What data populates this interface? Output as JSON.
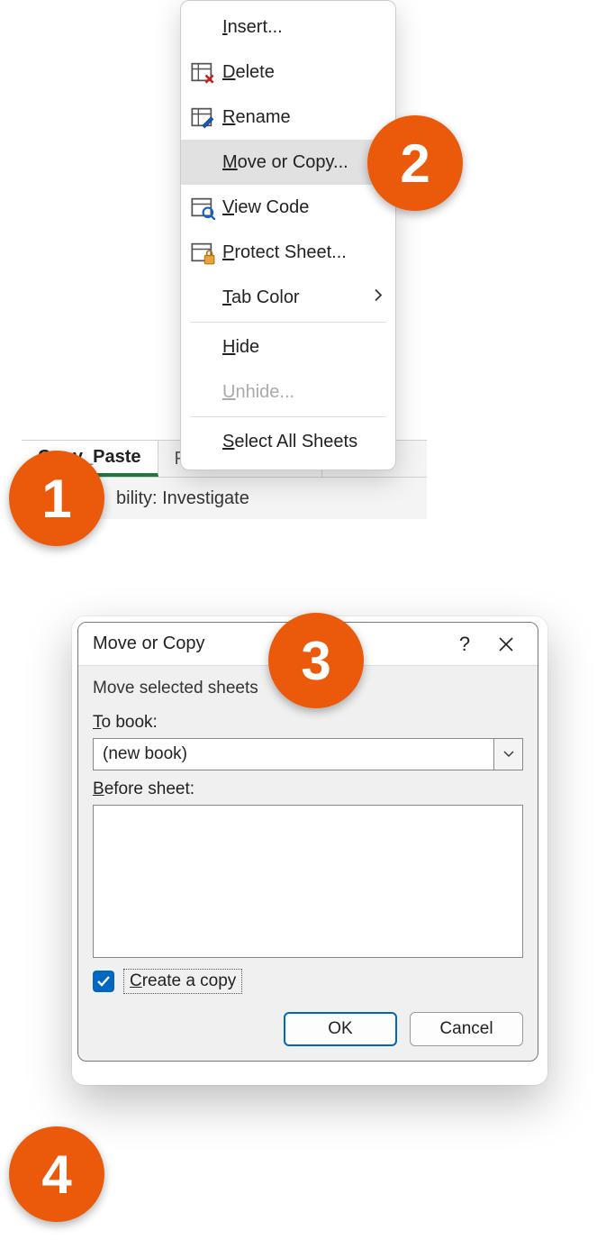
{
  "tabs": {
    "active": "Copy_Paste",
    "inactive": "Formula_Editing"
  },
  "accessibility_text": "bility: Investigate",
  "context_menu": {
    "insert": "Insert...",
    "delete": "Delete",
    "rename": "Rename",
    "move_or_copy": "Move or Copy...",
    "view_code": "View Code",
    "protect_sheet": "Protect Sheet...",
    "tab_color": "Tab Color",
    "hide": "Hide",
    "unhide": "Unhide...",
    "select_all": "Select All Sheets"
  },
  "dialog": {
    "title": "Move or Copy",
    "subheader": "Move selected sheets",
    "to_book_label": "To book:",
    "to_book_value": "(new book)",
    "before_sheet_label": "Before sheet:",
    "create_copy_label": "Create a copy",
    "create_copy_checked": true,
    "ok": "OK",
    "cancel": "Cancel"
  },
  "badges": {
    "b1": "1",
    "b2": "2",
    "b3": "3",
    "b4": "4"
  }
}
